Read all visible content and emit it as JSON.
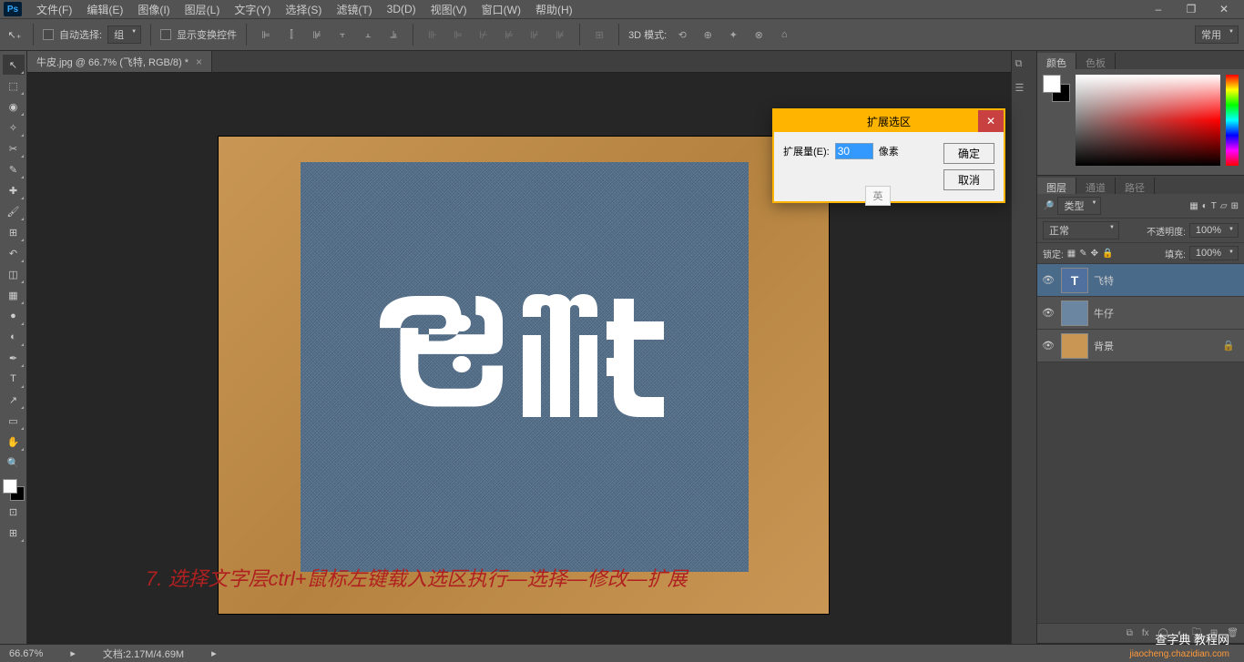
{
  "menu": [
    "文件(F)",
    "编辑(E)",
    "图像(I)",
    "图层(L)",
    "文字(Y)",
    "选择(S)",
    "滤镜(T)",
    "3D(D)",
    "视图(V)",
    "窗口(W)",
    "帮助(H)"
  ],
  "options": {
    "auto_select": "自动选择:",
    "group": "组",
    "show_transform": "显示变换控件",
    "mode_3d": "3D 模式:",
    "preset": "常用"
  },
  "doc_tab": {
    "title": "牛皮.jpg @ 66.7% (飞特, RGB/8) *"
  },
  "annotation": "7. 选择文字层ctrl+鼠标左键载入选区执行—选择—修改—扩展",
  "dialog": {
    "title": "扩展选区",
    "label": "扩展量(E):",
    "value": "30",
    "unit": "像素",
    "ok": "确定",
    "cancel": "取消"
  },
  "ime_label": "英",
  "panels": {
    "color": "颜色",
    "swatches": "色板",
    "layers": "图层",
    "channels": "通道",
    "paths": "路径"
  },
  "layers": {
    "type_filter": "类型",
    "blend_mode": "正常",
    "opacity_label": "不透明度:",
    "opacity_value": "100%",
    "lock_label": "锁定:",
    "fill_label": "填充:",
    "fill_value": "100%",
    "items": [
      {
        "name": "飞特",
        "kind": "type",
        "locked": false
      },
      {
        "name": "牛仔",
        "kind": "pixel",
        "locked": false
      },
      {
        "name": "背景",
        "kind": "bg",
        "locked": true
      }
    ]
  },
  "status": {
    "zoom": "66.67%",
    "doc": "文档:2.17M/4.69M"
  },
  "watermark": {
    "main": "查字典 教程网",
    "sub": "jiaocheng.chazidian.com"
  },
  "tool_icons": [
    "↖",
    "▭",
    "◑",
    "✎",
    "⌐",
    "✐",
    "≋",
    "⊹",
    "⌫",
    "∠",
    "◔",
    "●",
    "▲",
    "✎",
    "T",
    "↘",
    "✋",
    "✥",
    "🔍",
    "▭",
    "⊡"
  ]
}
